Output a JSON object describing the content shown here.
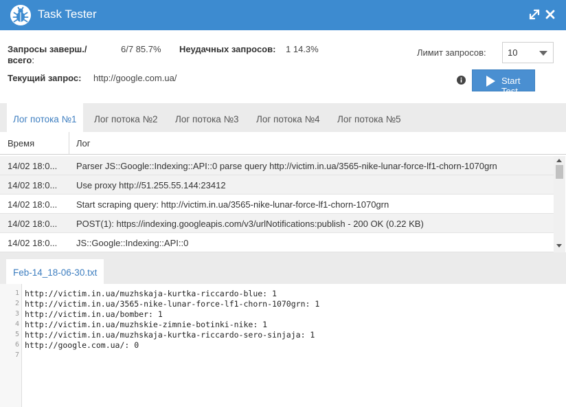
{
  "window": {
    "title": "Task Tester"
  },
  "stats": {
    "completed_label_line1": "Запросы заверш./",
    "completed_label_line2": "всего",
    "completed_label_colon": ":",
    "completed_value": "6/7 85.7%",
    "failed_label": "Неудачных запросов:",
    "failed_value": "1 14.3%",
    "current_label": "Текущий запрос:",
    "current_value": "http://google.com.ua/"
  },
  "controls": {
    "limit_label": "Лимит запросов:",
    "limit_value": "10",
    "start_label": "Start Test"
  },
  "thread_tabs": [
    "Лог потока №1",
    "Лог потока №2",
    "Лог потока №3",
    "Лог потока №4",
    "Лог потока №5"
  ],
  "active_tab": 0,
  "log": {
    "columns": [
      "Время",
      "Лог"
    ],
    "rows": [
      {
        "time": "14/02 18:0...",
        "message": "Parser JS::Google::Indexing::API::0 parse query http://victim.in.ua/3565-nike-lunar-force-lf1-chorn-1070grn"
      },
      {
        "time": "14/02 18:0...",
        "message": "Use proxy http://51.255.55.144:23412"
      },
      {
        "time": "14/02 18:0...",
        "message": "Start scraping query: http://victim.in.ua/3565-nike-lunar-force-lf1-chorn-1070grn"
      },
      {
        "time": "14/02 18:0...",
        "message": "POST(1): https://indexing.googleapis.com/v3/urlNotifications:publish - 200 OK (0.22 KB)"
      },
      {
        "time": "14/02 18:0...",
        "message": "JS::Google::Indexing::API::0"
      }
    ]
  },
  "file": {
    "tab_label": "Feb-14_18-06-30.txt",
    "lines": [
      "http://victim.in.ua/muzhskaja-kurtka-riccardo-blue: 1",
      "http://victim.in.ua/3565-nike-lunar-force-lf1-chorn-1070grn: 1",
      "http://victim.in.ua/bomber: 1",
      "http://victim.in.ua/muzhskie-zimnie-botinki-nike: 1",
      "http://victim.in.ua/muzhskaja-kurtka-riccardo-sero-sinjaja: 1",
      "http://google.com.ua/: 0",
      ""
    ]
  },
  "colors": {
    "accent": "#3d8bd0",
    "button": "#4a8fd1",
    "active_tab_text": "#3d7ec0"
  },
  "icons": [
    "bug-icon",
    "expand-icon",
    "close-icon",
    "info-icon",
    "play-icon",
    "chevron-down-icon"
  ]
}
